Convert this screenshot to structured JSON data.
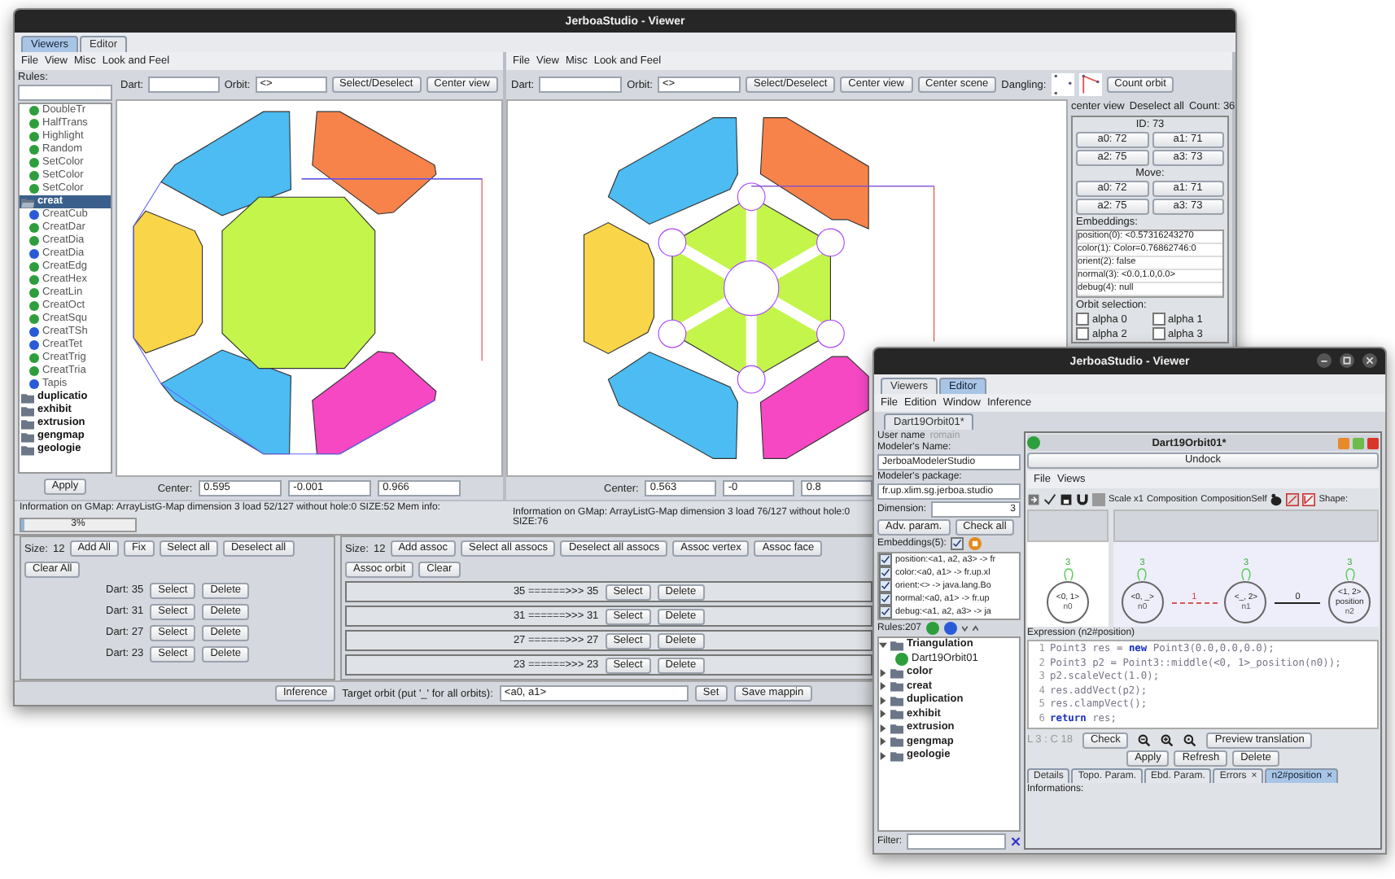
{
  "main_window": {
    "title": "JerboaStudio - Viewer",
    "tabs": [
      {
        "label": "Viewers",
        "selected": true
      },
      {
        "label": "Editor",
        "selected": false
      }
    ],
    "menu": [
      "File",
      "View",
      "Misc",
      "Look and Feel"
    ],
    "rules": {
      "label": "Rules:",
      "tree": [
        {
          "label": "DoubleTr",
          "kind": "a",
          "selected": false
        },
        {
          "label": "HalfTrans",
          "kind": "a",
          "selected": false
        },
        {
          "label": "Highlight",
          "kind": "a",
          "selected": false
        },
        {
          "label": "Random",
          "kind": "a",
          "selected": false
        },
        {
          "label": "SetColor",
          "kind": "a",
          "selected": false
        },
        {
          "label": "SetColor",
          "kind": "a",
          "selected": false
        },
        {
          "label": "SetColor",
          "kind": "a",
          "selected": false
        },
        {
          "label": "creat",
          "kind": "folder",
          "selected": true,
          "expanded": true,
          "children": [
            {
              "label": "CreatCub",
              "kind": "s",
              "selected": false
            },
            {
              "label": "CreatDar",
              "kind": "a",
              "selected": false
            },
            {
              "label": "CreatDia",
              "kind": "a",
              "selected": false
            },
            {
              "label": "CreatDia",
              "kind": "s",
              "selected": false
            },
            {
              "label": "CreatEdg",
              "kind": "a",
              "selected": false
            },
            {
              "label": "CreatHex",
              "kind": "a",
              "selected": false
            },
            {
              "label": "CreatLin",
              "kind": "a",
              "selected": false
            },
            {
              "label": "CreatOct",
              "kind": "a",
              "selected": false
            },
            {
              "label": "CreatSqu",
              "kind": "a",
              "selected": false
            },
            {
              "label": "CreatTSh",
              "kind": "s",
              "selected": false
            },
            {
              "label": "CreatTet",
              "kind": "s",
              "selected": false
            },
            {
              "label": "CreatTrig",
              "kind": "a",
              "selected": false
            },
            {
              "label": "CreatTria",
              "kind": "a",
              "selected": false
            },
            {
              "label": "Tapis",
              "kind": "s",
              "selected": false
            }
          ]
        },
        {
          "label": "duplicatio",
          "kind": "folder",
          "selected": false,
          "expanded": false
        },
        {
          "label": "exhibit",
          "kind": "folder",
          "selected": false,
          "expanded": false
        },
        {
          "label": "extrusion",
          "kind": "folder",
          "selected": false,
          "expanded": false
        },
        {
          "label": "gengmap",
          "kind": "folder",
          "selected": false,
          "expanded": false
        },
        {
          "label": "geologie",
          "kind": "folder",
          "selected": false,
          "expanded": false
        }
      ],
      "apply": "Apply"
    },
    "left_viewer": {
      "dart_label": "Dart:",
      "orbit_label": "Orbit:",
      "orbit_value": "<>",
      "buttons": [
        "Select/Deselect",
        "Center view"
      ],
      "center_label": "Center:",
      "center": [
        "0.595",
        "-0.001",
        "0.966"
      ],
      "info": "Information on GMap:  ArrayListG-Map dimension 3 load 52/127 without hole:0 SIZE:52 Mem info:",
      "mem": {
        "level": 0.03,
        "reading": "3%"
      }
    },
    "right_viewer": {
      "menu": [
        "File",
        "View",
        "Misc",
        "Look and Feel"
      ],
      "dart_label": "Dart:",
      "orbit_label": "Orbit:",
      "orbit_value": "<>",
      "buttons": [
        "Select/Deselect",
        "Center view",
        "Center scene"
      ],
      "dangling_label": "Dangling:",
      "count_button": "Count orbit",
      "center_label": "Center:",
      "center": [
        "0.563",
        "-0",
        "0.8"
      ],
      "info": "Information on GMap:  ArrayListG-Map dimension 3 load 76/127 without hole:0 SIZE:76"
    },
    "side_panel": {
      "actions": [
        "center view",
        "Deselect all"
      ],
      "count": "Count: 36",
      "id": "ID: 73",
      "alphas": [
        "a0: 72",
        "a1: 71",
        "a2: 75",
        "a3: 73"
      ],
      "move_label": "Move:",
      "move": [
        "a0: 72",
        "a1: 71",
        "a2: 75",
        "a3: 73"
      ],
      "embeddings_label": "Embeddings:",
      "embeddings": [
        "position(0): <0.57316243270",
        "color(1): Color=0.76862746:0",
        "orient(2): false",
        "normal(3): <0.0,1.0,0.0>",
        "debug(4): null"
      ],
      "orbit_label": "Orbit selection:",
      "orbits": [
        {
          "label": "alpha 0",
          "checked": false
        },
        {
          "label": "alpha 1",
          "checked": false
        },
        {
          "label": "alpha 2",
          "checked": false
        },
        {
          "label": "alpha 3",
          "checked": false
        }
      ]
    },
    "marks": {
      "size_label": "Size:",
      "size": "12",
      "buttons": [
        "Add All",
        "Fix",
        "Select all",
        "Deselect all",
        "Clear All"
      ],
      "rows": [
        {
          "label": "Dart: 35",
          "buttons": [
            "Select",
            "Delete"
          ]
        },
        {
          "label": "Dart: 31",
          "buttons": [
            "Select",
            "Delete"
          ]
        },
        {
          "label": "Dart: 27",
          "buttons": [
            "Select",
            "Delete"
          ]
        },
        {
          "label": "Dart: 23",
          "buttons": [
            "Select",
            "Delete"
          ]
        }
      ]
    },
    "assocs": {
      "size_label": "Size:",
      "size": "12",
      "buttons": [
        "Add assoc",
        "Select all assocs",
        "Deselect all assocs",
        "Assoc vertex",
        "Assoc face",
        "Assoc orbit",
        "Clear"
      ],
      "rows": [
        {
          "label": "35 ======>>> 35",
          "buttons": [
            "Select",
            "Delete"
          ]
        },
        {
          "label": "31 ======>>> 31",
          "buttons": [
            "Select",
            "Delete"
          ]
        },
        {
          "label": "27 ======>>> 27",
          "buttons": [
            "Select",
            "Delete"
          ]
        },
        {
          "label": "23 ======>>> 23",
          "buttons": [
            "Select",
            "Delete"
          ]
        }
      ]
    },
    "bottom_bar": {
      "inference": "Inference",
      "target_label": "Target orbit (put '_' for all orbits):",
      "target_value": "<a0, a1>",
      "set": "Set",
      "save": "Save mappin"
    }
  },
  "editor_window": {
    "title": "JerboaStudio - Viewer",
    "tabs": [
      {
        "label": "Viewers",
        "selected": false
      },
      {
        "label": "Editor",
        "selected": true
      }
    ],
    "menu": [
      "File",
      "Edition",
      "Window",
      "Inference"
    ],
    "doc_tab": "Dart19Orbit01*",
    "user": {
      "label": "User name",
      "value": "romain"
    },
    "modeler_name": {
      "label": "Modeler's Name:",
      "value": "JerboaModelerStudio"
    },
    "modeler_package": {
      "label": "Modeler's package:",
      "value": "fr.up.xlim.sg.jerboa.studio"
    },
    "dimension": {
      "label": "Dimension:",
      "value": "3"
    },
    "param_buttons": [
      "Adv. param.",
      "Check all"
    ],
    "embeddings": {
      "label": "Embeddings(5):",
      "checked": true,
      "items": [
        {
          "label": "position:<a1, a2, a3> -> fr",
          "checked": true
        },
        {
          "label": "color:<a0, a1> -> fr.up.xl",
          "checked": true
        },
        {
          "label": "orient:<> -> java.lang.Bo",
          "checked": true
        },
        {
          "label": "normal:<a0, a1> -> fr.up",
          "checked": true
        },
        {
          "label": "debug:<a1, a2, a3> -> ja",
          "checked": true
        }
      ]
    },
    "rules_count": "Rules:207",
    "tree": [
      {
        "label": "Triangulation",
        "kind": "folder",
        "expanded": true,
        "children": [
          {
            "label": "Dart19Orbit01",
            "kind": "a"
          }
        ]
      },
      {
        "label": "color",
        "kind": "folder",
        "expanded": false
      },
      {
        "label": "creat",
        "kind": "folder",
        "expanded": false
      },
      {
        "label": "duplication",
        "kind": "folder",
        "expanded": false
      },
      {
        "label": "exhibit",
        "kind": "folder",
        "expanded": false
      },
      {
        "label": "extrusion",
        "kind": "folder",
        "expanded": false
      },
      {
        "label": "gengmap",
        "kind": "folder",
        "expanded": false
      },
      {
        "label": "geologie",
        "kind": "folder",
        "expanded": false
      }
    ],
    "filter_label": "Filter:",
    "frame": {
      "title": "Dart19Orbit01*",
      "undock": "Undock",
      "menu": [
        "File",
        "Views"
      ],
      "toolbar_labels": [
        "Scale x1",
        "Composition",
        "CompositionSelf"
      ],
      "shape_label": "Shape:",
      "left_graph": {
        "nodes": [
          {
            "label": "<0, 1>",
            "id": "n0",
            "loop": "3"
          }
        ]
      },
      "right_graph": {
        "nodes": [
          {
            "label": "<0, _>",
            "id": "n0",
            "loop": "3"
          },
          {
            "label": "<_, 2>",
            "id": "n1",
            "loop": "3"
          },
          {
            "label": "<1, 2>",
            "sub": "position",
            "id": "n2",
            "loop": "3"
          }
        ],
        "edges": [
          {
            "label": "1",
            "kind": "dashed"
          },
          {
            "label": "0",
            "kind": "solid"
          }
        ]
      },
      "expression_label": "Expression (n2#position)",
      "code": [
        {
          "n": "1",
          "text": "Point3 res = **new** Point3(0.0,0.0,0.0);"
        },
        {
          "n": "2",
          "text": "Point3 p2 = Point3::middle(<0, 1>_position(n0));"
        },
        {
          "n": "3",
          "text": "p2.scaleVect(1.0);"
        },
        {
          "n": "4",
          "text": "res.addVect(p2);"
        },
        {
          "n": "5",
          "text": "res.clampVect();"
        },
        {
          "n": "6",
          "text": "**return** res;"
        }
      ],
      "cursor": "L 3 : C 18",
      "check": "Check",
      "preview": "Preview translation",
      "actions": [
        "Apply",
        "Refresh",
        "Delete"
      ],
      "tabs": [
        {
          "label": "Details",
          "selected": false
        },
        {
          "label": "Topo. Param.",
          "selected": false
        },
        {
          "label": "Ebd. Param.",
          "selected": false
        },
        {
          "label": "Errors",
          "close": "×",
          "selected": false
        },
        {
          "label": "n2#position",
          "close": "×",
          "selected": true
        }
      ],
      "informations": "Informations:"
    }
  }
}
